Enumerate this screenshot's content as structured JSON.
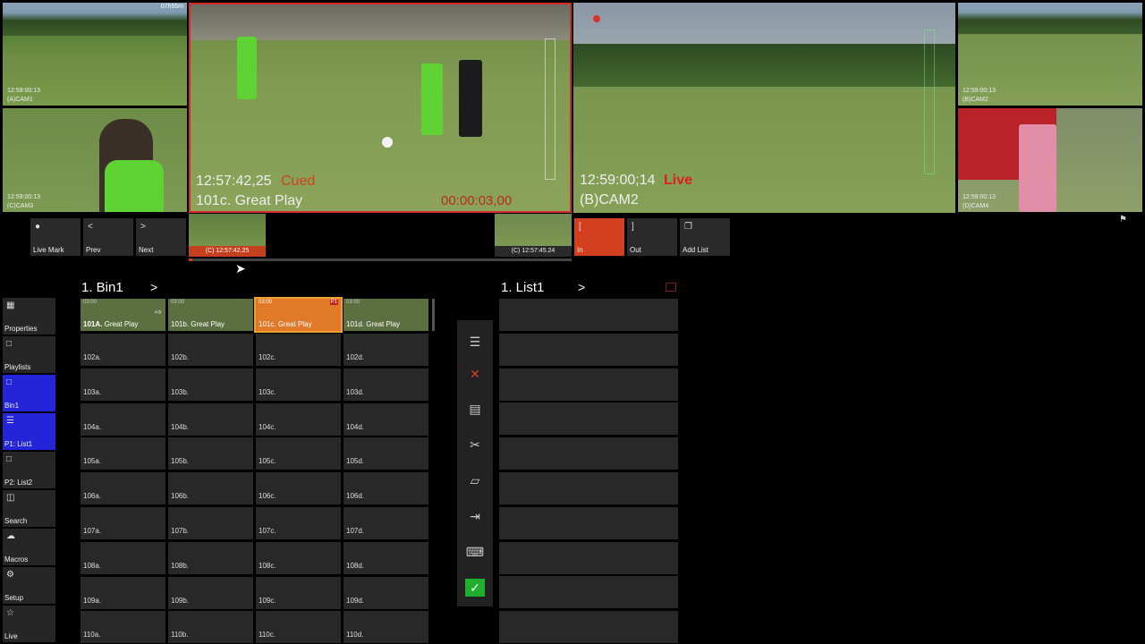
{
  "tiles": {
    "cam1": {
      "timecode": "12:59:00:13",
      "camera": "(A)CAM1",
      "clock": "07h55m"
    },
    "cam3": {
      "timecode": "12:59:00:13",
      "camera": "(C)CAM3"
    },
    "cam2_small": {
      "timecode": "12:59:00:13",
      "camera": "(B)CAM2"
    },
    "cam4": {
      "timecode": "12:59:00:13",
      "camera": "(D)CAM4"
    }
  },
  "preview": {
    "timecode": "12:57:42,25",
    "status": "Cued",
    "clip_name": "101c. Great Play",
    "duration": "00:00:03,00"
  },
  "program": {
    "timecode": "12:59:00;14",
    "status": "Live",
    "camera": "(B)CAM2"
  },
  "transport": {
    "live_mark": "Live Mark",
    "prev": "Prev",
    "next": "Next",
    "in": "In",
    "out": "Out",
    "add_list": "Add List",
    "thumb_left": "(C) 12:57:42.25",
    "thumb_right": "(C) 12:57:45.24"
  },
  "sidebar": [
    {
      "label": "Properties",
      "icon": "document-icon"
    },
    {
      "label": "Playlists",
      "icon": "square-icon"
    },
    {
      "label": "Bin1",
      "icon": "square-icon"
    },
    {
      "label": "P1: List1",
      "icon": "list-icon"
    },
    {
      "label": "P2: List2",
      "icon": "square-icon"
    },
    {
      "label": "Search",
      "icon": "search-icon"
    },
    {
      "label": "Macros",
      "icon": "cloud-icon"
    },
    {
      "label": "Setup",
      "icon": "gear-icon"
    },
    {
      "label": "Live",
      "icon": "star-icon"
    }
  ],
  "bin": {
    "title": "1. Bin1",
    "clips": [
      {
        "id": "101A.",
        "name": "Great Play",
        "duration": "03:00"
      },
      {
        "id": "101b.",
        "name": "Great Play",
        "duration": "03:00"
      },
      {
        "id": "101c.",
        "name": "Great Play",
        "duration": "03:00",
        "badge": "P1"
      },
      {
        "id": "101d.",
        "name": "Great Play",
        "duration": "03:00"
      }
    ],
    "rows": [
      [
        "102a.",
        "102b.",
        "102c.",
        "102d."
      ],
      [
        "103a.",
        "103b.",
        "103c.",
        "103d."
      ],
      [
        "104a.",
        "104b.",
        "104c.",
        "104d."
      ],
      [
        "105a.",
        "105b.",
        "105c.",
        "105d."
      ],
      [
        "106a.",
        "106b.",
        "106c.",
        "106d."
      ],
      [
        "107a.",
        "107b.",
        "107c.",
        "107d."
      ],
      [
        "108a.",
        "108b.",
        "108c.",
        "108d."
      ],
      [
        "109a.",
        "109b.",
        "109c.",
        "109d."
      ],
      [
        "110a.",
        "110b.",
        "110c.",
        "110d."
      ]
    ]
  },
  "list": {
    "title": "1. List1"
  },
  "colors": {
    "cued": "#d2401f",
    "live": "#e21d1d",
    "selected": "#2424d8",
    "in_button": "#d2401f"
  }
}
